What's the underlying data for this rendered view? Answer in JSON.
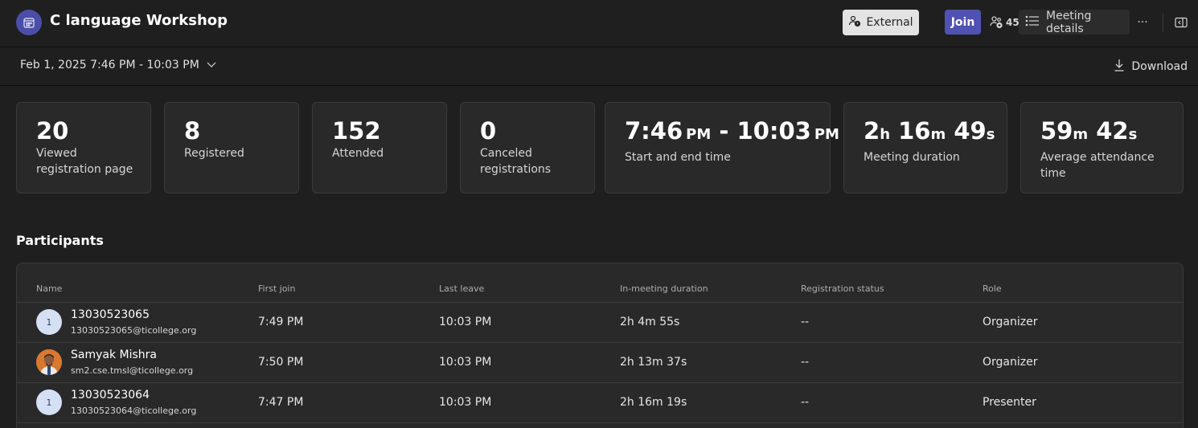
{
  "header": {
    "title": "C language Workshop",
    "app_icon": "calendar-icon",
    "external_label": "External",
    "join_label": "Join",
    "participants_count": "45",
    "meeting_details_label": "Meeting details",
    "more_label": "···"
  },
  "subheader": {
    "date_range": "Feb 1, 2025 7:46 PM - 10:03 PM",
    "download_label": "Download"
  },
  "stats": {
    "viewed": {
      "value": "20",
      "label": "Viewed registration page"
    },
    "registered": {
      "value": "8",
      "label": "Registered"
    },
    "attended": {
      "value": "152",
      "label": "Attended"
    },
    "canceled": {
      "value": "0",
      "label": "Canceled registrations"
    },
    "start_end": {
      "start": "7:46",
      "start_unit": "PM",
      "sep": "-",
      "end": "10:03",
      "end_unit": "PM",
      "label": "Start and end time"
    },
    "duration": {
      "h": "2",
      "h_unit": "h",
      "m": "16",
      "m_unit": "m",
      "s": "49",
      "s_unit": "s",
      "label": "Meeting duration"
    },
    "avg_attendance": {
      "m": "59",
      "m_unit": "m",
      "s": "42",
      "s_unit": "s",
      "label": "Average attendance time"
    }
  },
  "participants": {
    "title": "Participants",
    "columns": [
      "Name",
      "First join",
      "Last leave",
      "In-meeting duration",
      "Registration status",
      "Role"
    ],
    "rows": [
      {
        "initial": "1",
        "name": "13030523065",
        "email": "13030523065@ticollege.org",
        "first_join": "7:49 PM",
        "last_leave": "10:03 PM",
        "duration": "2h 4m 55s",
        "status": "--",
        "role": "Organizer"
      },
      {
        "initial": "",
        "name": "Samyak Mishra",
        "email": "sm2.cse.tmsl@ticollege.org",
        "first_join": "7:50 PM",
        "last_leave": "10:03 PM",
        "duration": "2h 13m 37s",
        "status": "--",
        "role": "Organizer"
      },
      {
        "initial": "1",
        "name": "13030523064",
        "email": "13030523064@ticollege.org",
        "first_join": "7:47 PM",
        "last_leave": "10:03 PM",
        "duration": "2h 16m 19s",
        "status": "--",
        "role": "Presenter"
      }
    ]
  },
  "colors": {
    "background": "#1f1f1f",
    "card": "#292929",
    "join": "#4f52b2",
    "external_bg": "#e3e3e3"
  }
}
